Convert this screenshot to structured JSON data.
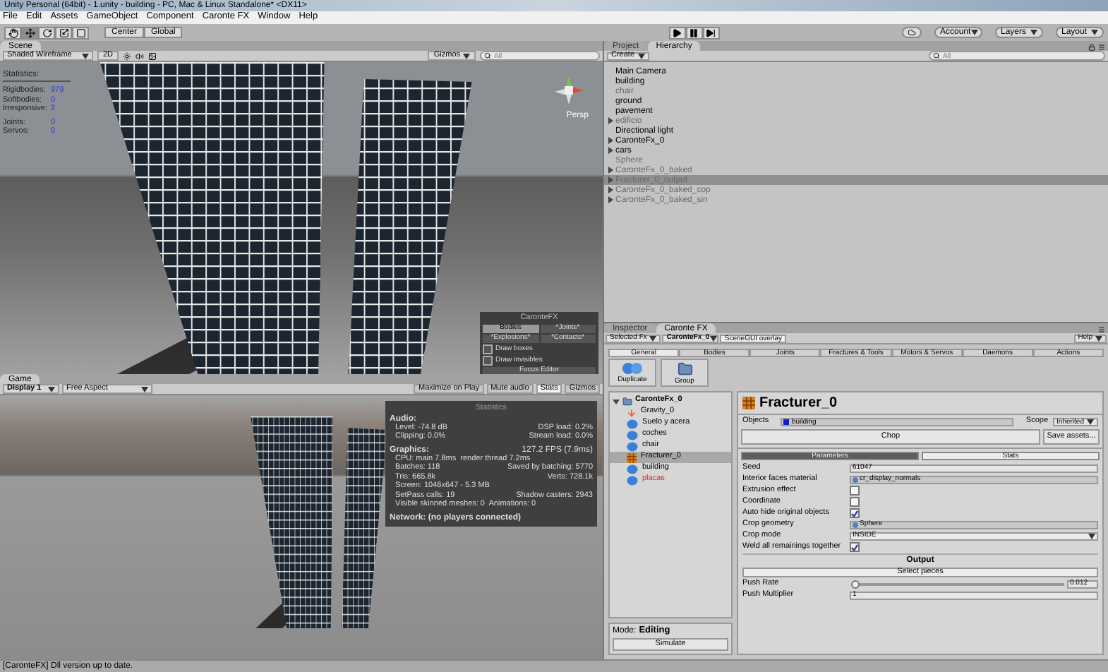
{
  "window": {
    "title": "Unity Personal (64bit) - 1.unity - building - PC, Mac & Linux Standalone* <DX11>"
  },
  "menu": [
    "File",
    "Edit",
    "Assets",
    "GameObject",
    "Component",
    "Caronte FX",
    "Window",
    "Help"
  ],
  "toolbar": {
    "pivot": [
      "Center",
      "Global"
    ],
    "right": [
      "Account",
      "Layers",
      "Layout"
    ]
  },
  "scene": {
    "tab": "Scene",
    "shading": "Shaded Wireframe",
    "mode_2d": "2D",
    "gizmos": "Gizmos",
    "search": {
      "placeholder": "All"
    },
    "camera": "Persp",
    "statistics": {
      "title": "Statistics:",
      "rows": [
        {
          "label": "Rigidbodies:",
          "value": "979"
        },
        {
          "label": "Softbodies:",
          "value": "0"
        },
        {
          "label": "Irresponsive:",
          "value": "2"
        },
        {
          "label": "Joints:",
          "value": "0"
        },
        {
          "label": "Servos:",
          "value": "0"
        }
      ]
    },
    "caronte_overlay": {
      "title": "CaronteFX",
      "buttons": [
        {
          "label": "Bodies",
          "selected": true
        },
        {
          "label": "*Joints*",
          "selected": false
        },
        {
          "label": "*Explosions*",
          "selected": false
        },
        {
          "label": "*Contacts*",
          "selected": false
        }
      ],
      "options": [
        {
          "label": "Draw boxes",
          "checked": false
        },
        {
          "label": "Draw invisibles",
          "checked": false
        }
      ],
      "focus": "Focus Editor"
    }
  },
  "game": {
    "tab": "Game",
    "display": "Display 1",
    "aspect": "Free Aspect",
    "toggles": [
      {
        "label": "Maximize on Play",
        "selected": false
      },
      {
        "label": "Mute audio",
        "selected": false
      },
      {
        "label": "Stats",
        "selected": true
      },
      {
        "label": "Gizmos",
        "selected": false
      }
    ],
    "stats": {
      "title": "Statistics",
      "sections": [
        {
          "heading": "Audio:",
          "lines": [
            [
              "Level: -74.8 dB",
              "DSP load: 0.2%"
            ],
            [
              "Clipping: 0.0%",
              "Stream load: 0.0%"
            ]
          ]
        },
        {
          "heading": "Graphics:",
          "aside": "127.2 FPS (7.9ms)",
          "lines": [
            [
              "CPU: main 7.8ms  render thread 7.2ms"
            ],
            [
              "Batches: 118",
              "Saved by batching: 5770"
            ],
            [
              "Tris: 665.8k",
              "Verts: 728.1k"
            ],
            [
              "Screen: 1046x647 - 5.3 MB"
            ],
            [
              "SetPass calls: 19",
              "Shadow casters: 2943"
            ],
            [
              "Visible skinned meshes: 0  Animations: 0"
            ]
          ]
        }
      ],
      "network": "Network: (no players connected)"
    }
  },
  "hierarchy": {
    "tabs": [
      {
        "label": "Project",
        "selected": false
      },
      {
        "label": "Hierarchy",
        "selected": true
      }
    ],
    "create": "Create",
    "search": {
      "placeholder": "All"
    },
    "items": [
      {
        "name": "Main Camera",
        "active": true,
        "expandable": false,
        "selected": false
      },
      {
        "name": "building",
        "active": true,
        "expandable": false,
        "selected": false
      },
      {
        "name": "chair",
        "active": false,
        "expandable": false,
        "selected": false
      },
      {
        "name": "ground",
        "active": true,
        "expandable": false,
        "selected": false
      },
      {
        "name": "pavement",
        "active": true,
        "expandable": false,
        "selected": false
      },
      {
        "name": "edificio",
        "active": false,
        "expandable": true,
        "selected": false
      },
      {
        "name": "Directional light",
        "active": true,
        "expandable": false,
        "selected": false
      },
      {
        "name": "CaronteFx_0",
        "active": true,
        "expandable": true,
        "selected": false
      },
      {
        "name": "cars",
        "active": true,
        "expandable": true,
        "selected": false
      },
      {
        "name": "Sphere",
        "active": false,
        "expandable": false,
        "selected": false
      },
      {
        "name": "CaronteFx_0_baked",
        "active": false,
        "expandable": true,
        "selected": false
      },
      {
        "name": "Fracturer_0_output",
        "active": false,
        "expandable": true,
        "selected": true
      },
      {
        "name": "CaronteFx_0_baked_cop",
        "active": false,
        "expandable": true,
        "selected": false
      },
      {
        "name": "CaronteFx_0_baked_sin",
        "active": false,
        "expandable": true,
        "selected": false
      }
    ]
  },
  "caronte": {
    "tabs": [
      {
        "label": "Inspector",
        "selected": false
      },
      {
        "label": "Caronte FX",
        "selected": true
      }
    ],
    "selected_fx": "Selected Fx",
    "fx": "CaronteFx_0",
    "overlay": "SceneGUI overlay",
    "help": "Help",
    "sections": [
      {
        "label": "General",
        "selected": true
      },
      {
        "label": "Bodies",
        "selected": false
      },
      {
        "label": "Joints",
        "selected": false
      },
      {
        "label": "Fractures & Tools",
        "selected": false
      },
      {
        "label": "Motors & Servos",
        "selected": false
      },
      {
        "label": "Daemons",
        "selected": false
      },
      {
        "label": "Actions",
        "selected": false
      }
    ],
    "actions": [
      {
        "label": "Duplicate",
        "kind": "bodies"
      },
      {
        "label": "Group",
        "kind": "folder"
      }
    ],
    "tree": {
      "name": "CaronteFx_0",
      "expanded": true,
      "children": [
        {
          "name": "Gravity_0",
          "kind": "daemon",
          "selected": false,
          "enabled": true
        },
        {
          "name": "Suelo y acera",
          "kind": "body",
          "selected": false,
          "enabled": true
        },
        {
          "name": "coches",
          "kind": "body",
          "selected": false,
          "enabled": true
        },
        {
          "name": "chair",
          "kind": "body",
          "selected": false,
          "enabled": true
        },
        {
          "name": "Fracturer_0",
          "kind": "tool",
          "selected": true,
          "enabled": true
        },
        {
          "name": "building",
          "kind": "body",
          "selected": false,
          "enabled": true
        },
        {
          "name": "placas",
          "kind": "body",
          "selected": false,
          "enabled": false
        }
      ]
    },
    "mode": {
      "label": "Mode:",
      "value": "Editing"
    },
    "simulate": "Simulate",
    "node": {
      "title": "Fracturer_0",
      "objects_label": "Objects",
      "objects": "building",
      "scope_label": "Scope",
      "scope": "Inherited",
      "chop": "Chop",
      "save": "Save assets...",
      "tabs": [
        {
          "label": "Parameters",
          "selected": true
        },
        {
          "label": "Stats",
          "selected": false
        }
      ],
      "params": [
        {
          "kind": "text",
          "label": "Seed",
          "value": "61047"
        },
        {
          "kind": "object",
          "label": "Interior faces material",
          "value": "cr_display_normals"
        },
        {
          "kind": "checkbox",
          "label": "Extrusion effect",
          "checked": false
        },
        {
          "kind": "checkbox",
          "label": "Coordinate",
          "checked": false
        },
        {
          "kind": "checkbox",
          "label": "Auto hide original objects",
          "checked": true
        },
        {
          "kind": "object",
          "label": "Crop geometry",
          "value": "Sphere"
        },
        {
          "kind": "dropdown",
          "label": "Crop mode",
          "value": "INSIDE"
        },
        {
          "kind": "checkbox",
          "label": "Weld all remainings together",
          "checked": true
        },
        {
          "kind": "heading",
          "label": "Output"
        },
        {
          "kind": "button",
          "label": "Select pieces"
        },
        {
          "kind": "slider",
          "label": "Push Rate",
          "level": 0.01,
          "value": "0.012"
        },
        {
          "kind": "text",
          "label": "Push Multiplier",
          "value": "1"
        }
      ]
    }
  },
  "status_bar": "[CaronteFX] Dll version up to date."
}
